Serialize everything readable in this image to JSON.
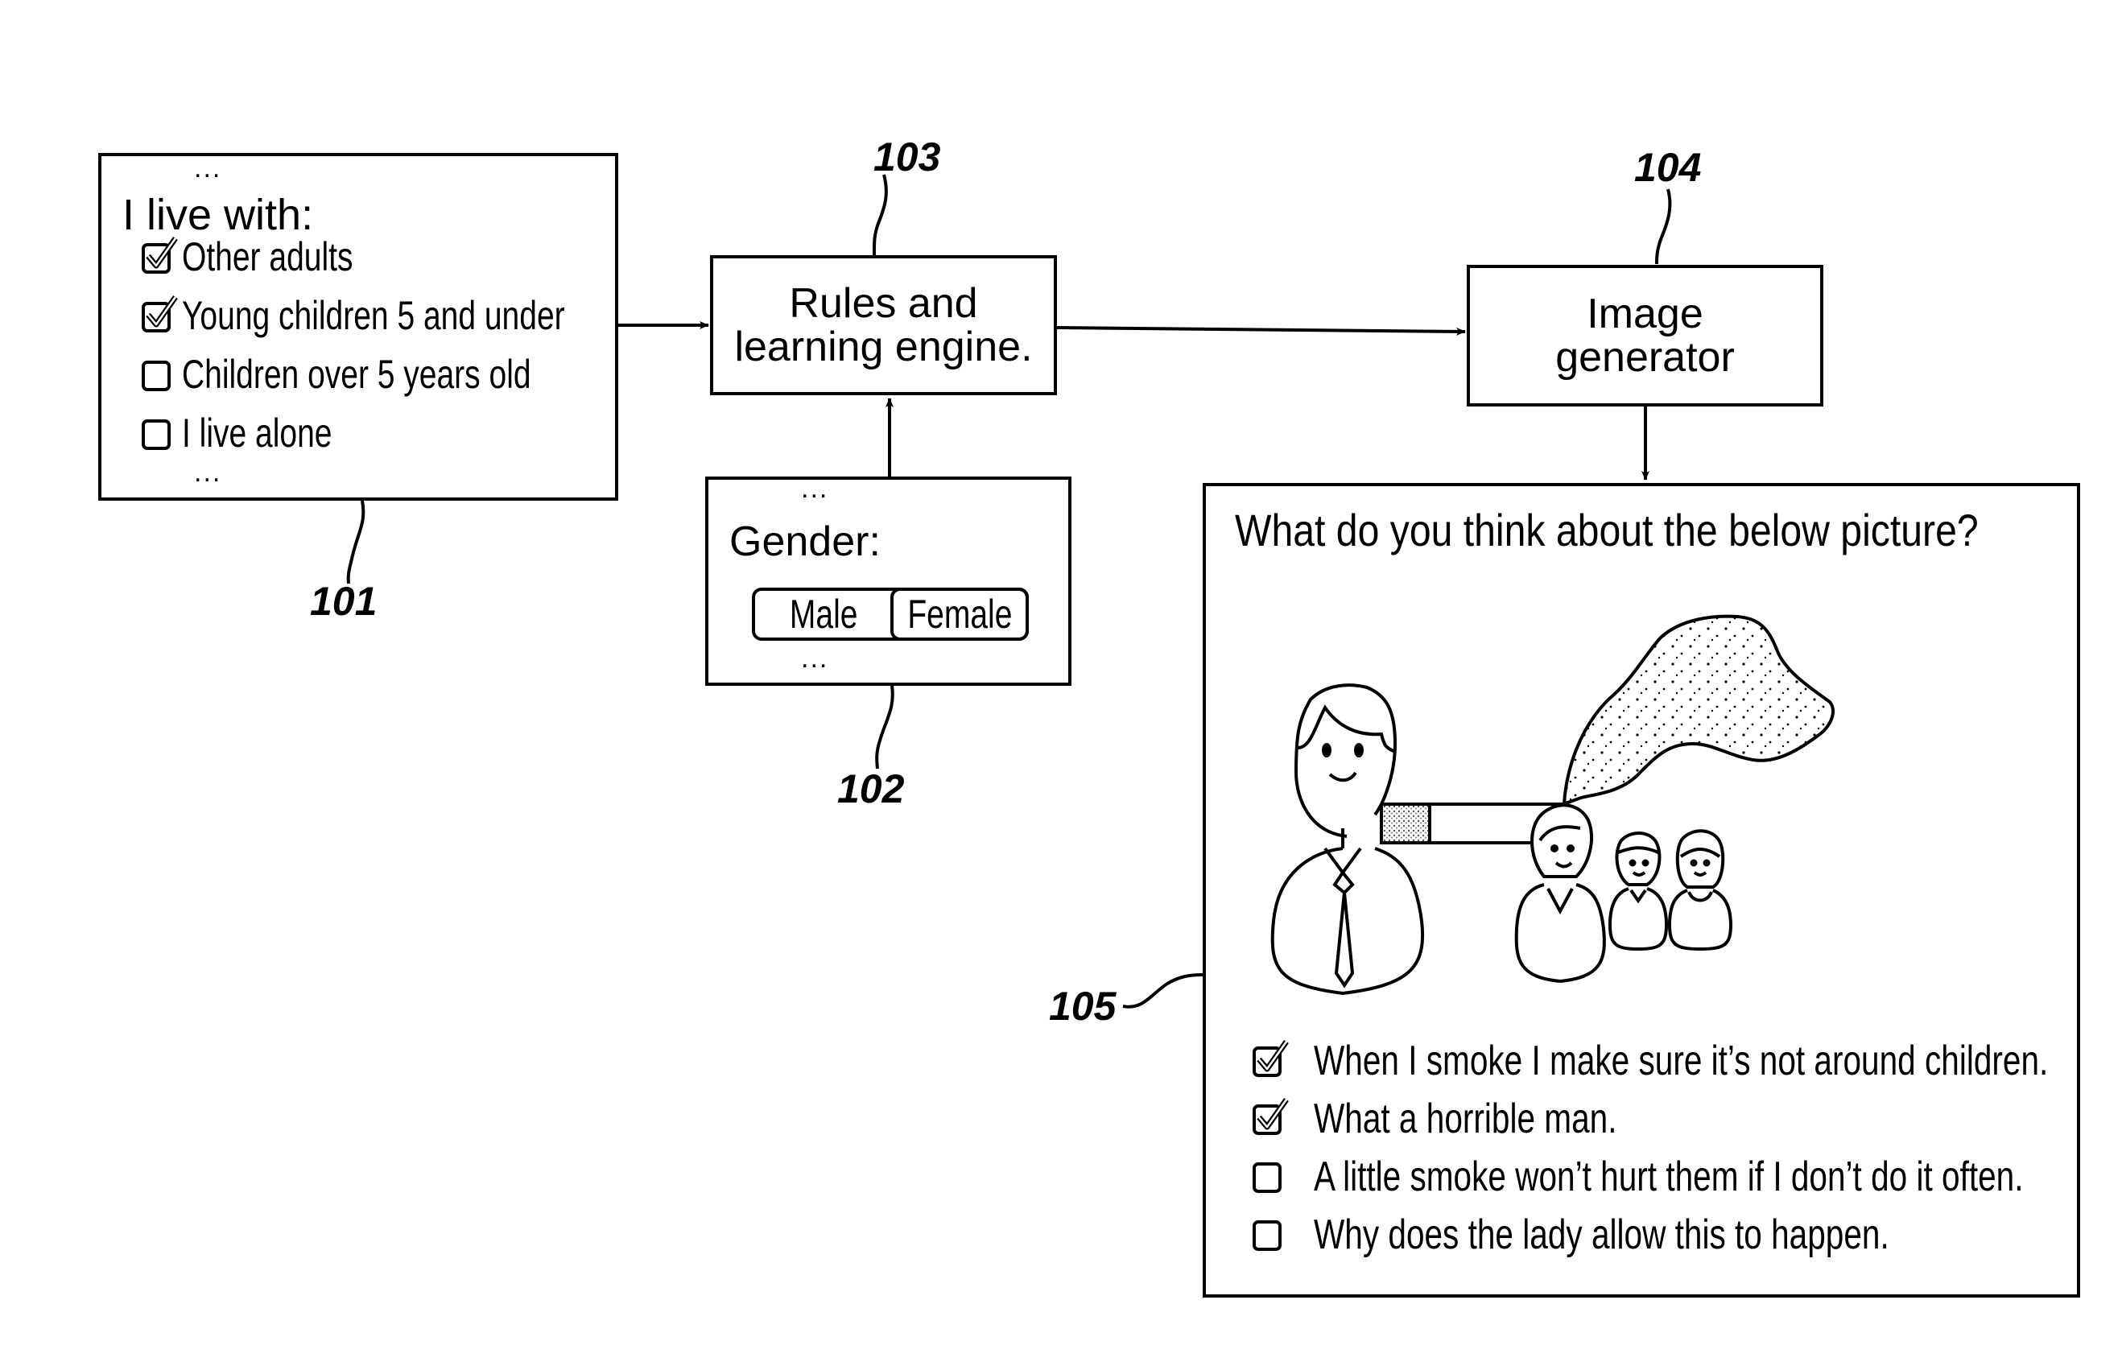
{
  "figure": {
    "references": {
      "r101": "101",
      "r102": "102",
      "r103": "103",
      "r104": "104",
      "r105": "105"
    },
    "box101": {
      "ellipsis_top": "...",
      "title": "I live with:",
      "options": [
        {
          "label": "Other adults",
          "checked": true
        },
        {
          "label": "Young children 5 and under",
          "checked": true
        },
        {
          "label": "Children over 5 years old",
          "checked": false
        },
        {
          "label": "I live alone",
          "checked": false
        }
      ],
      "ellipsis_bottom": "..."
    },
    "box102": {
      "ellipsis_top": "...",
      "title": "Gender:",
      "toggle": {
        "options": [
          "Male",
          "Female"
        ],
        "selected": "Female"
      },
      "ellipsis_bottom": "..."
    },
    "box103": {
      "line1": "Rules and",
      "line2": "learning engine."
    },
    "box104": {
      "line1": "Image",
      "line2": "generator"
    },
    "box105": {
      "question": "What do you think about the below picture?",
      "illustration": {
        "subjects": [
          "smoking-man",
          "cigarette",
          "smoke-cloud",
          "woman",
          "child",
          "girl"
        ]
      },
      "options": [
        {
          "label": "When I smoke I make sure it’s not around children.",
          "checked": true
        },
        {
          "label": "What a horrible man.",
          "checked": true
        },
        {
          "label": "A little smoke won’t hurt them if I don’t do it often.",
          "checked": false
        },
        {
          "label": "Why does the lady allow this to happen.",
          "checked": false
        }
      ]
    }
  }
}
